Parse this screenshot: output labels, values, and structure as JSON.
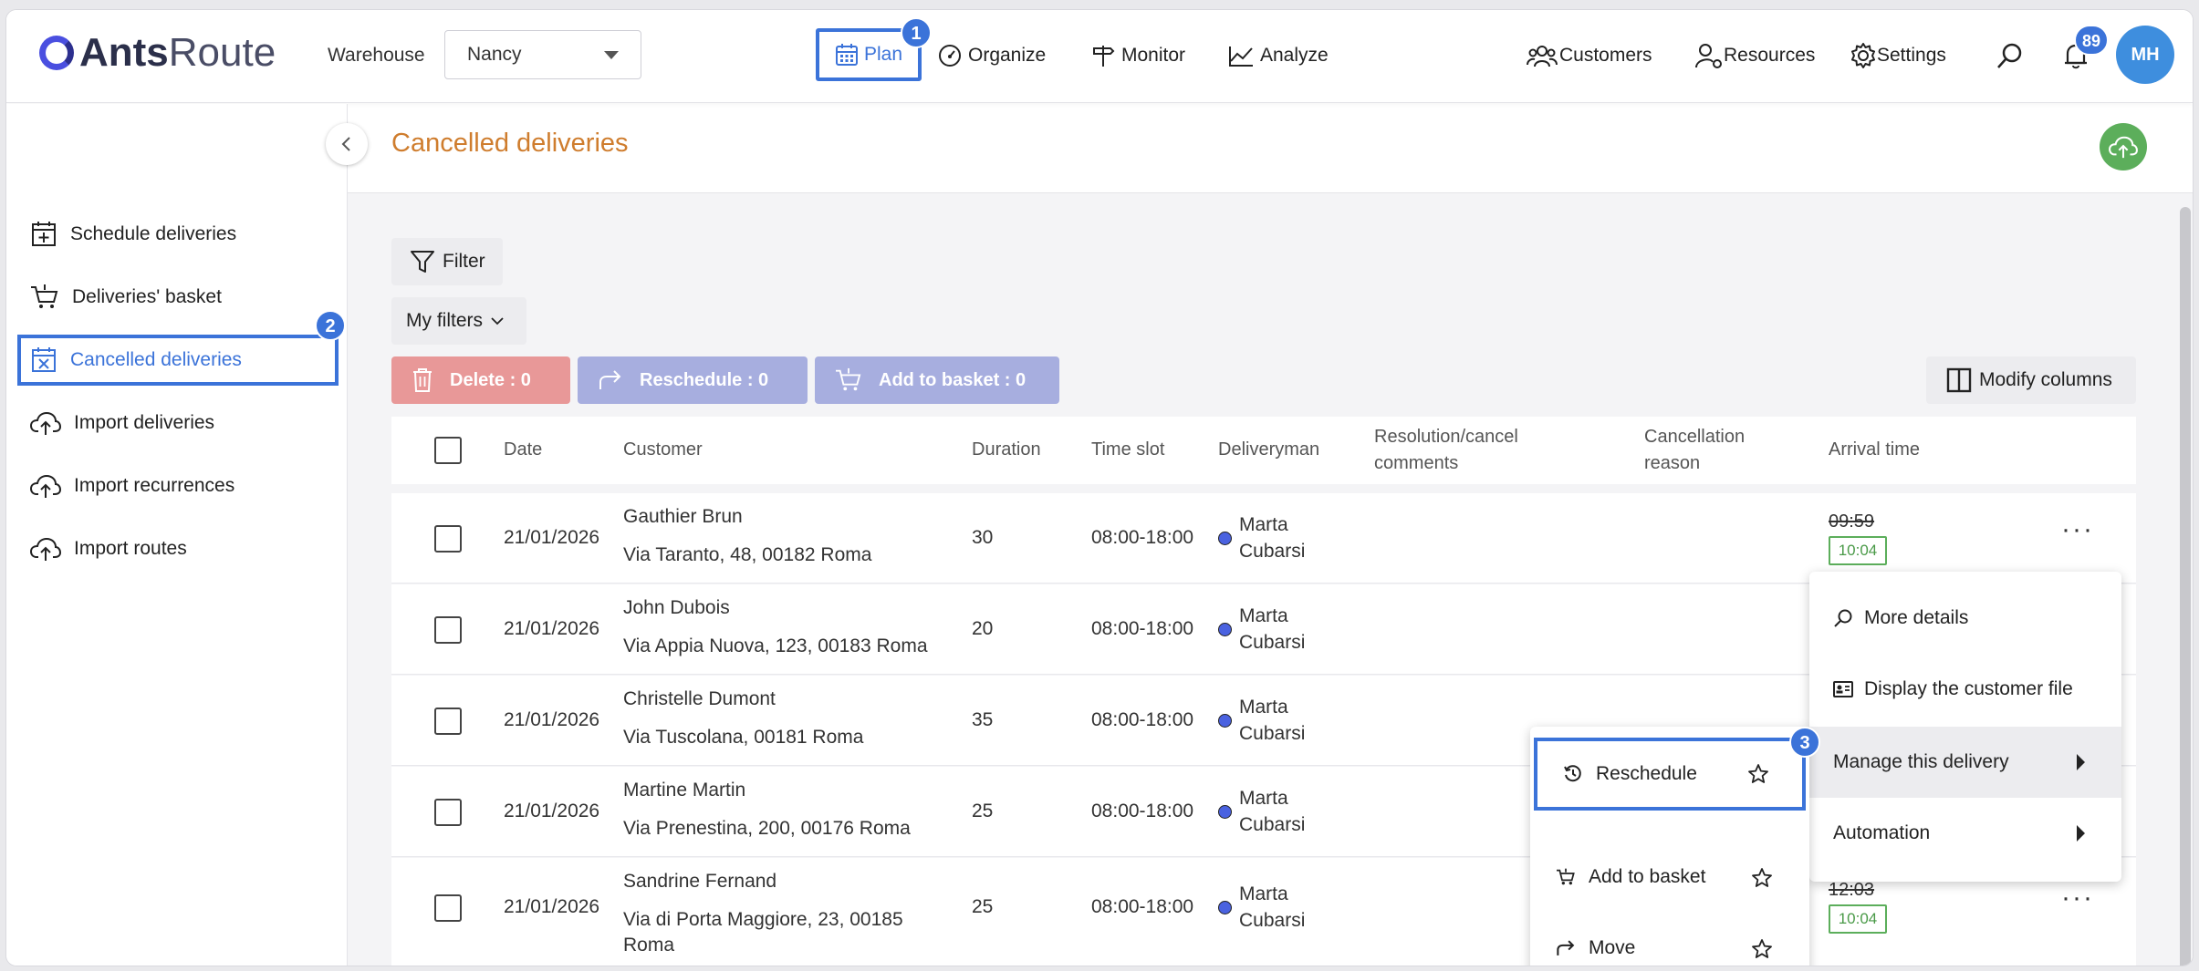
{
  "app": {
    "logo_bold": "Ants",
    "logo_light": "Route"
  },
  "header": {
    "warehouse_label": "Warehouse",
    "warehouse_value": "Nancy",
    "nav": {
      "plan": "Plan",
      "organize": "Organize",
      "monitor": "Monitor",
      "analyze": "Analyze"
    },
    "right": {
      "customers": "Customers",
      "resources": "Resources",
      "settings": "Settings"
    },
    "notifications_count": "89",
    "avatar_initials": "MH"
  },
  "step_badges": {
    "one": "1",
    "two": "2",
    "three": "3"
  },
  "sidebar": {
    "items": [
      {
        "label": "Schedule deliveries"
      },
      {
        "label": "Deliveries' basket"
      },
      {
        "label": "Cancelled deliveries"
      },
      {
        "label": "Import deliveries"
      },
      {
        "label": "Import recurrences"
      },
      {
        "label": "Import routes"
      }
    ]
  },
  "page": {
    "title": "Cancelled deliveries"
  },
  "toolbar": {
    "filter": "Filter",
    "my_filters": "My filters",
    "delete": "Delete : 0",
    "reschedule": "Reschedule : 0",
    "add_to_basket": "Add to basket : 0",
    "modify_columns": "Modify columns"
  },
  "table": {
    "headers": {
      "date": "Date",
      "customer": "Customer",
      "duration": "Duration",
      "time_slot": "Time slot",
      "deliveryman": "Deliveryman",
      "resolution_1": "Resolution/cancel",
      "resolution_2": "comments",
      "cancellation_1": "Cancellation",
      "cancellation_2": "reason",
      "arrival": "Arrival time"
    },
    "rows": [
      {
        "date": "21/01/2026",
        "name": "Gauthier Brun",
        "address": "Via Taranto, 48, 00182 Roma",
        "address2": "",
        "duration": "30",
        "slot": "08:00-18:00",
        "dm1": "Marta",
        "dm2": "Cubarsi",
        "arr_old": "09:59",
        "arr_new": "10:04"
      },
      {
        "date": "21/01/2026",
        "name": "John Dubois",
        "address": "Via Appia Nuova, 123, 00183 Roma",
        "address2": "",
        "duration": "20",
        "slot": "08:00-18:00",
        "dm1": "Marta",
        "dm2": "Cubarsi",
        "arr_old": "",
        "arr_new": ""
      },
      {
        "date": "21/01/2026",
        "name": "Christelle Dumont",
        "address": "Via Tuscolana, 00181 Roma",
        "address2": "",
        "duration": "35",
        "slot": "08:00-18:00",
        "dm1": "Marta",
        "dm2": "Cubarsi",
        "arr_old": "",
        "arr_new": ""
      },
      {
        "date": "21/01/2026",
        "name": "Martine Martin",
        "address": "Via Prenestina, 200, 00176 Roma",
        "address2": "",
        "duration": "25",
        "slot": "08:00-18:00",
        "dm1": "Marta",
        "dm2": "Cubarsi",
        "arr_old": "",
        "arr_new": ""
      },
      {
        "date": "21/01/2026",
        "name": "Sandrine Fernand",
        "address": "Via di Porta Maggiore, 23, 00185",
        "address2": "Roma",
        "duration": "25",
        "slot": "08:00-18:00",
        "dm1": "Marta",
        "dm2": "Cubarsi",
        "arr_old": "12:03",
        "arr_new": "10:04"
      }
    ]
  },
  "context_menu": {
    "more_details": "More details",
    "display_customer_file": "Display the customer file",
    "manage_delivery": "Manage this delivery",
    "automation": "Automation"
  },
  "submenu": {
    "reschedule": "Reschedule",
    "add_to_basket": "Add to basket",
    "move": "Move"
  },
  "colors": {
    "accent": "#3b73d9",
    "title_orange": "#cf7d2e",
    "delete_red": "#e89898",
    "action_lavender": "#a7aedf",
    "success_green": "#5cae5b"
  }
}
